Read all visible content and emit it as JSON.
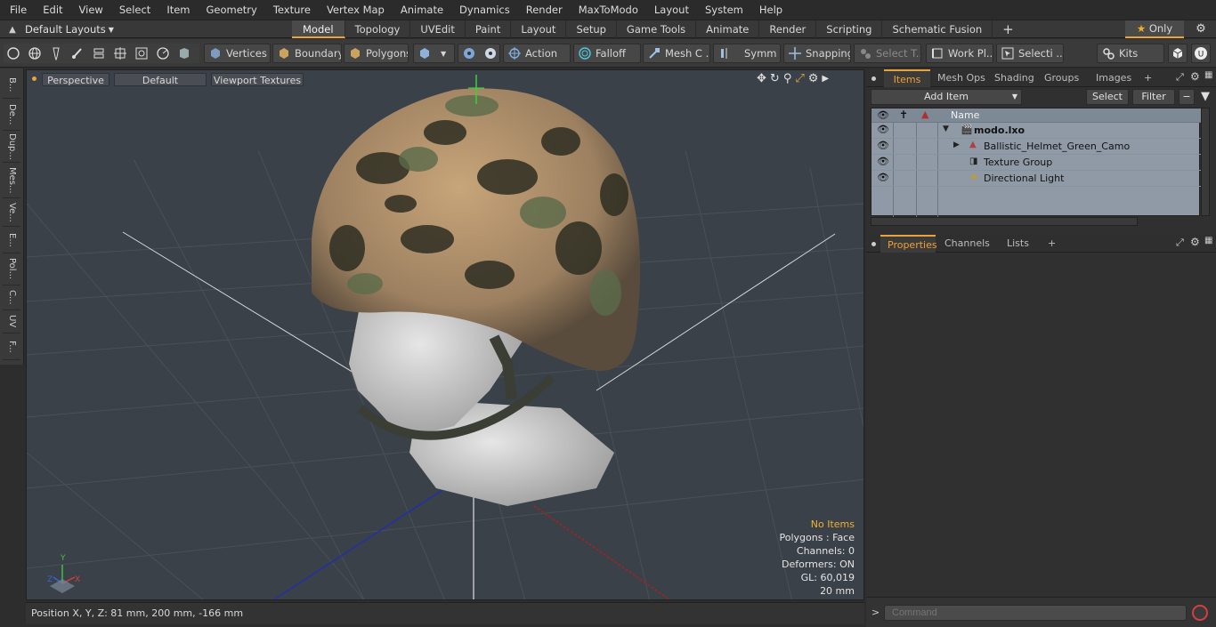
{
  "menu": [
    "File",
    "Edit",
    "View",
    "Select",
    "Item",
    "Geometry",
    "Texture",
    "Vertex Map",
    "Animate",
    "Dynamics",
    "Render",
    "MaxToModo",
    "Layout",
    "System",
    "Help"
  ],
  "layout_selector": "Default Layouts",
  "tabs": [
    "Model",
    "Topology",
    "UVEdit",
    "Paint",
    "Layout",
    "Setup",
    "Game Tools",
    "Animate",
    "Render",
    "Scripting",
    "Schematic Fusion"
  ],
  "tabs_active": "Model",
  "only_label": "Only",
  "toolbar": {
    "vertices": "Vertices",
    "boundary": "Boundary",
    "polygons": "Polygons",
    "action": "Action",
    "falloff": "Falloff",
    "mesh": "Mesh C ...",
    "symm": "Symm ...",
    "snapping": "Snapping",
    "select_t": "Select T...",
    "work_pl": "Work Pl...",
    "selecti": "Selecti ...",
    "kits": "Kits"
  },
  "left_strip": [
    "B...",
    "De...",
    "Dup...",
    "Mes...",
    "Ve...",
    "E...",
    "Pol...",
    "C...",
    "UV",
    "F..."
  ],
  "viewport": {
    "tabs": [
      "Perspective",
      "Default",
      "Viewport Textures"
    ],
    "info": {
      "selection": "No Items",
      "polygons": "Polygons : Face",
      "channels": "Channels: 0",
      "deformers": "Deformers: ON",
      "gl": "GL: 60,019",
      "scale": "20 mm"
    },
    "axis": {
      "x": "X",
      "y": "Y",
      "z": "Z"
    }
  },
  "status": {
    "position": "Position X, Y, Z:   81 mm, 200 mm, -166 mm"
  },
  "items_panel": {
    "tabs": [
      "Items",
      "Mesh Ops",
      "Shading",
      "Groups",
      "Images"
    ],
    "add_item": "Add Item",
    "select": "Select",
    "filter": "Filter",
    "name_header": "Name",
    "rows": [
      "modo.lxo",
      "Ballistic_Helmet_Green_Camo",
      "Texture Group",
      "Directional Light"
    ]
  },
  "props_panel": {
    "tabs": [
      "Properties",
      "Channels",
      "Lists"
    ]
  },
  "command_placeholder": "Command",
  "colors": {
    "accent": "#e8a33a",
    "viewport_bg": "#3b4148",
    "item_list_bg": "#8f9aa6"
  }
}
